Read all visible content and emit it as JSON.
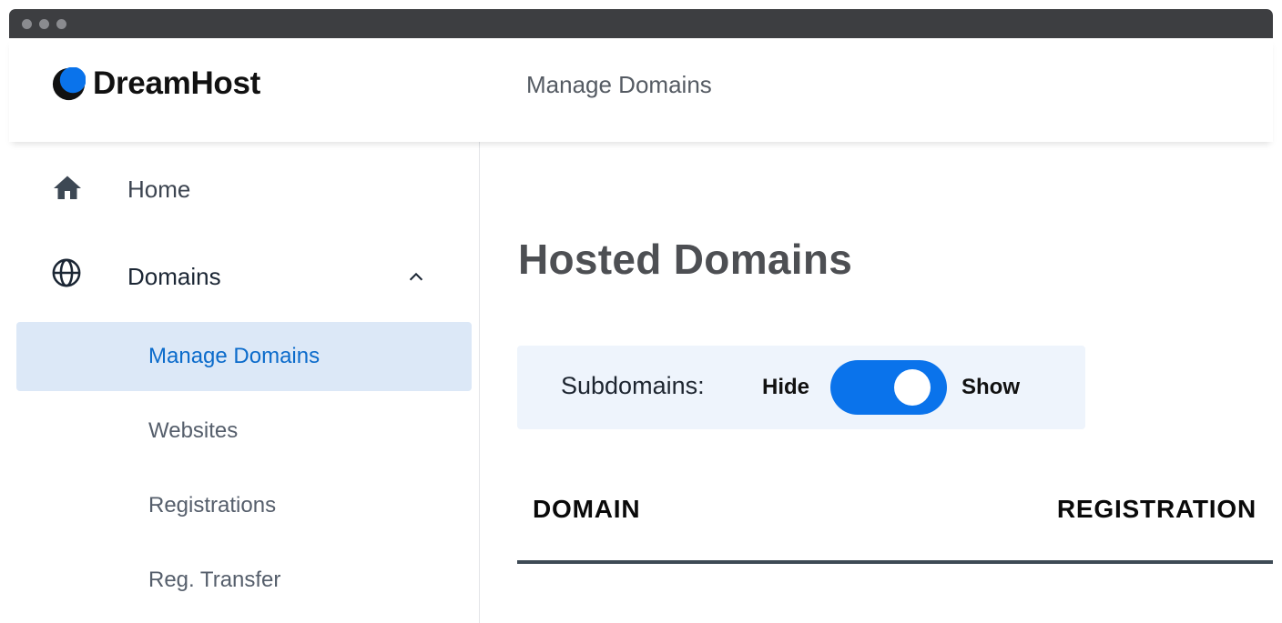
{
  "app": {
    "logo_text": "DreamHost",
    "brand_color": "#0a73eb"
  },
  "header": {
    "title": "Manage Domains"
  },
  "sidebar": {
    "items": [
      {
        "label": "Home",
        "icon": "home-icon"
      },
      {
        "label": "Domains",
        "icon": "globe-icon",
        "expanded": true
      }
    ],
    "sub_items": [
      {
        "label": "Manage Domains",
        "active": true
      },
      {
        "label": "Websites",
        "active": false
      },
      {
        "label": "Registrations",
        "active": false
      },
      {
        "label": "Reg. Transfer",
        "active": false
      }
    ]
  },
  "main": {
    "heading": "Hosted Domains",
    "filter": {
      "label": "Subdomains:",
      "hide_label": "Hide",
      "show_label": "Show",
      "state": "Show"
    },
    "table": {
      "columns": [
        "DOMAIN",
        "REGISTRATION"
      ]
    }
  }
}
